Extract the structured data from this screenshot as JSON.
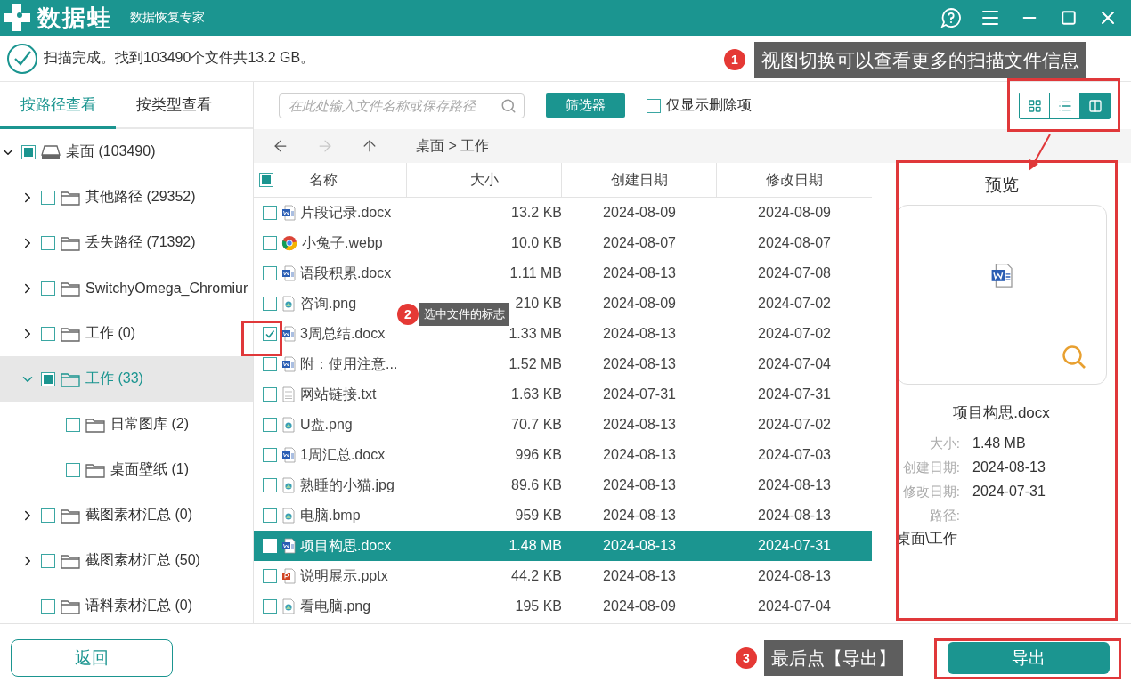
{
  "title_bar": {
    "app_name": "数据蛙",
    "subtitle": "数据恢复专家"
  },
  "scan_status": "扫描完成。找到103490个文件共13.2 GB。",
  "view_tabs": [
    {
      "label": "按路径查看",
      "selected": true
    },
    {
      "label": "按类型查看",
      "selected": false
    }
  ],
  "tree": [
    {
      "label": "桌面 (103490)",
      "kind": "drive",
      "checked": false,
      "partial": true,
      "expanded": true,
      "selected": false,
      "children": [
        {
          "label": "其他路径 (29352)",
          "kind": "folder",
          "checked": false,
          "partial": false,
          "expanded": false,
          "selected": false
        },
        {
          "label": "丢失路径 (71392)",
          "kind": "folder",
          "checked": false,
          "partial": false,
          "expanded": false,
          "selected": false
        },
        {
          "label": "SwitchyOmega_Chromiur",
          "kind": "folder",
          "checked": false,
          "partial": false,
          "expanded": false,
          "selected": false
        },
        {
          "label": "工作 (0)",
          "kind": "folder",
          "checked": false,
          "partial": false,
          "expanded": false,
          "selected": false
        },
        {
          "label": "工作 (33)",
          "kind": "folder",
          "checked": false,
          "partial": true,
          "expanded": true,
          "selected": true,
          "children": [
            {
              "label": "日常图库 (2)",
              "kind": "folder",
              "checked": false,
              "partial": false,
              "selected": false
            },
            {
              "label": "桌面壁纸 (1)",
              "kind": "folder",
              "checked": false,
              "partial": false,
              "selected": false
            }
          ]
        },
        {
          "label": "截图素材汇总 (0)",
          "kind": "folder",
          "checked": false,
          "partial": false,
          "expanded": false,
          "selected": false
        },
        {
          "label": "截图素材汇总 (50)",
          "kind": "folder",
          "checked": false,
          "partial": false,
          "expanded": false,
          "selected": false
        },
        {
          "label": "语料素材汇总 (0)",
          "kind": "folder",
          "checked": false,
          "partial": false,
          "selected": false
        }
      ]
    }
  ],
  "toolbar": {
    "search": {
      "placeholder": "在此处输入文件名称或保存路径"
    },
    "filter_button": "筛选器",
    "deleted_only": {
      "label": "仅显示删除项",
      "checked": false
    },
    "view_modes": [
      {
        "kind": "grid",
        "selected": false
      },
      {
        "kind": "list",
        "selected": false
      },
      {
        "kind": "split",
        "selected": true
      }
    ]
  },
  "nav": {
    "buttons": [
      {
        "kind": "back",
        "disabled": false
      },
      {
        "kind": "forward",
        "disabled": true
      },
      {
        "kind": "up",
        "disabled": false
      }
    ],
    "breadcrumb": "桌面 > 工作"
  },
  "table": {
    "select_all": {
      "checked": false,
      "partial": true
    },
    "columns": [
      "名称",
      "大小",
      "创建日期",
      "修改日期"
    ],
    "rows": [
      {
        "name": "片段记录.docx",
        "kind": "word",
        "size": "13.2 KB",
        "created": "2024-08-09",
        "modified": "2024-08-09",
        "checked": false,
        "selected": false
      },
      {
        "name": "小兔子.webp",
        "kind": "browser",
        "size": "10.0 KB",
        "created": "2024-08-07",
        "modified": "2024-08-07",
        "checked": false,
        "selected": false
      },
      {
        "name": "语段积累.docx",
        "kind": "word",
        "size": "1.11 MB",
        "created": "2024-08-13",
        "modified": "2024-07-08",
        "checked": false,
        "selected": false
      },
      {
        "name": "咨询.png",
        "kind": "image",
        "size": "210 KB",
        "created": "2024-08-09",
        "modified": "2024-07-02",
        "checked": false,
        "selected": false
      },
      {
        "name": "3周总结.docx",
        "kind": "word",
        "size": "1.33 MB",
        "created": "2024-08-13",
        "modified": "2024-07-02",
        "checked": true,
        "selected": false
      },
      {
        "name": "附：使用注意...",
        "kind": "word",
        "size": "1.52 MB",
        "created": "2024-08-13",
        "modified": "2024-07-04",
        "checked": false,
        "selected": false
      },
      {
        "name": "网站链接.txt",
        "kind": "text",
        "size": "1.63 KB",
        "created": "2024-07-31",
        "modified": "2024-07-31",
        "checked": false,
        "selected": false
      },
      {
        "name": "U盘.png",
        "kind": "image",
        "size": "70.7 KB",
        "created": "2024-08-13",
        "modified": "2024-07-02",
        "checked": false,
        "selected": false
      },
      {
        "name": "1周汇总.docx",
        "kind": "word",
        "size": "996 KB",
        "created": "2024-08-13",
        "modified": "2024-07-03",
        "checked": false,
        "selected": false
      },
      {
        "name": "熟睡的小猫.jpg",
        "kind": "image",
        "size": "89.6 KB",
        "created": "2024-08-13",
        "modified": "2024-08-13",
        "checked": false,
        "selected": false
      },
      {
        "name": "电脑.bmp",
        "kind": "image",
        "size": "959 KB",
        "created": "2024-08-13",
        "modified": "2024-08-13",
        "checked": false,
        "selected": false
      },
      {
        "name": "项目构思.docx",
        "kind": "word",
        "size": "1.48 MB",
        "created": "2024-08-13",
        "modified": "2024-07-31",
        "checked": false,
        "selected": true
      },
      {
        "name": "说明展示.pptx",
        "kind": "slides",
        "size": "44.2 KB",
        "created": "2024-08-13",
        "modified": "2024-08-13",
        "checked": false,
        "selected": false
      },
      {
        "name": "看电脑.png",
        "kind": "image",
        "size": "195 KB",
        "created": "2024-08-09",
        "modified": "2024-07-04",
        "checked": false,
        "selected": false
      }
    ]
  },
  "preview": {
    "title": "预览",
    "kind": "word",
    "file_name": "项目构思.docx",
    "details": [
      {
        "label": "大小:",
        "value": "1.48 MB"
      },
      {
        "label": "创建日期:",
        "value": "2024-08-13"
      },
      {
        "label": "修改日期:",
        "value": "2024-07-31"
      },
      {
        "label": "路径:"
      }
    ],
    "path": "桌面\\工作"
  },
  "footer": {
    "back_button": "返回",
    "export_button": "导出"
  },
  "annotations": [
    {
      "number": "1",
      "text": "视图切换可以查看更多的扫描文件信息"
    },
    {
      "number": "2",
      "text": "选中文件的标志"
    },
    {
      "number": "3",
      "text": "最后点【导出】"
    }
  ]
}
